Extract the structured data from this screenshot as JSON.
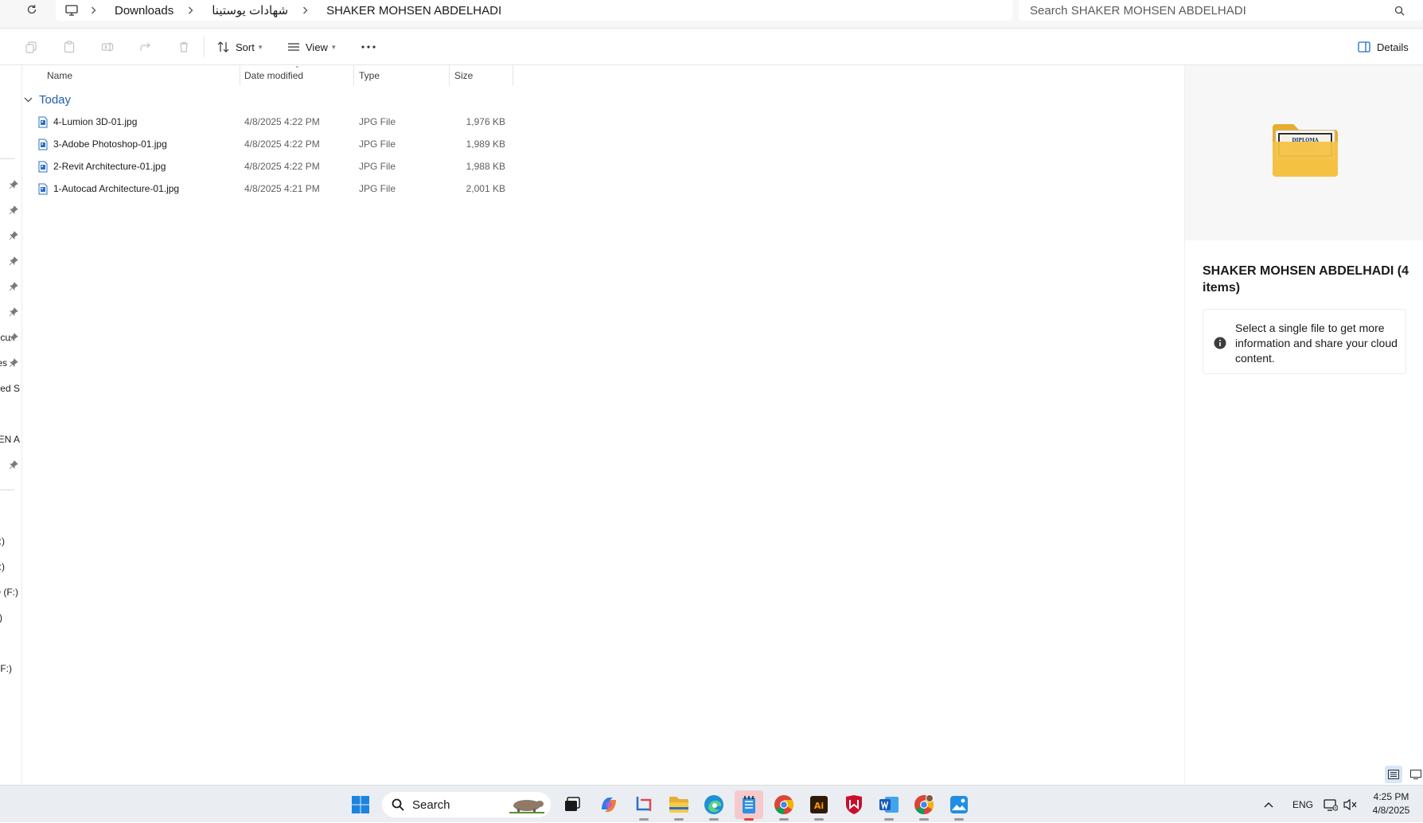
{
  "address_bar": {
    "breadcrumbs": [
      "Downloads",
      "شهادات يوستينا",
      "SHAKER MOHSEN ABDELHADI"
    ],
    "search_placeholder": "Search SHAKER MOHSEN ABDELHADI"
  },
  "command_bar": {
    "sort_label": "Sort",
    "view_label": "View",
    "details_label": "Details"
  },
  "nav_pane": {
    "clipped_labels": [
      "cu",
      "es",
      "lied S",
      "SEN A",
      ":)",
      ":)",
      "D (F:)",
      ")",
      "(F:)"
    ]
  },
  "file_list": {
    "columns": [
      "Name",
      "Date modified",
      "Type",
      "Size"
    ],
    "group": "Today",
    "files": [
      {
        "name": "4-Lumion 3D-01.jpg",
        "date": "4/8/2025 4:22 PM",
        "type": "JPG File",
        "size": "1,976 KB"
      },
      {
        "name": "3-Adobe Photoshop-01.jpg",
        "date": "4/8/2025 4:22 PM",
        "type": "JPG File",
        "size": "1,989 KB"
      },
      {
        "name": "2-Revit Architecture-01.jpg",
        "date": "4/8/2025 4:22 PM",
        "type": "JPG File",
        "size": "1,988 KB"
      },
      {
        "name": "1-Autocad Architecture-01.jpg",
        "date": "4/8/2025 4:21 PM",
        "type": "JPG File",
        "size": "2,001 KB"
      }
    ]
  },
  "details_pane": {
    "title": "SHAKER MOHSEN ABDELHADI (4 items)",
    "info_text": "Select a single file to get more information and share your cloud content.",
    "thumbnail_text": "DIPLOMA"
  },
  "taskbar": {
    "search_label": "Search",
    "language": "ENG",
    "time": "4:25 PM",
    "date": "4/8/2025"
  },
  "colors": {
    "accent": "#1a6dc9",
    "group_header": "#1f5fb4",
    "folder": "#f4c245",
    "taskbar_bg": "#eaeef2",
    "active_app_highlight": "#f6c9cc"
  }
}
